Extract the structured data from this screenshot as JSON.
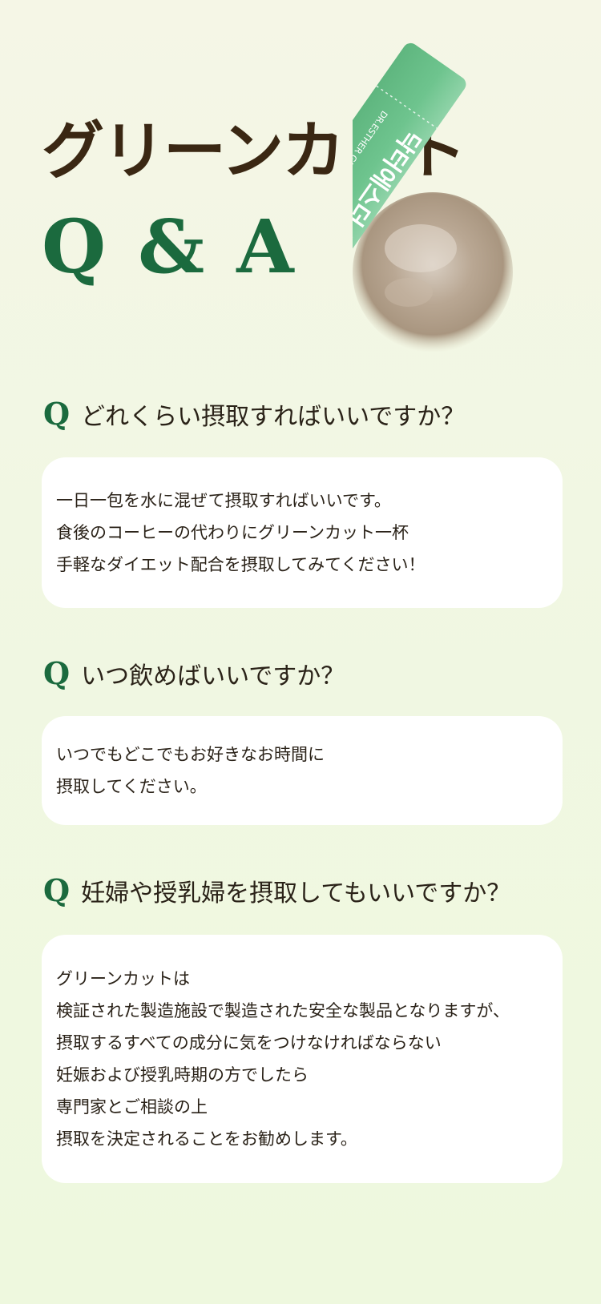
{
  "hero": {
    "title": "グリーンカット",
    "subtitle": "Q & A",
    "product": {
      "stick_label": "닥터에스더 그린",
      "stick_sublabel": "DR.ESTHER GREEN CUT",
      "colors": {
        "stick": "#6bbf8a",
        "stick_dark": "#4ea672",
        "powder": "#b7a591"
      }
    }
  },
  "colors": {
    "title": "#3a2713",
    "accent_green": "#1b6a3e",
    "card": "#ffffff",
    "text": "#2a2218"
  },
  "qa": [
    {
      "q_mark": "Q",
      "question": "どれくらい摂取すればいいですか？",
      "answer_lines": [
        "一日一包を水に混ぜて摂取すればいいです。",
        "食後のコーヒーの代わりにグリーンカット一杯",
        "手軽なダイエット配合を摂取してみてください！"
      ]
    },
    {
      "q_mark": "Q",
      "question": "いつ飲めばいいですか？",
      "answer_lines": [
        "いつでもどこでもお好きなお時間に",
        "摂取してください。"
      ]
    },
    {
      "q_mark": "Q",
      "question": "妊婦や授乳婦を摂取してもいいですか？",
      "answer_lines": [
        "グリーンカットは",
        "検証された製造施設で製造された安全な製品となりますが、",
        "摂取するすべての成分に気をつけなければならない",
        "妊娠および授乳時期の方でしたら",
        "専門家とご相談の上",
        "摂取を決定されることをお勧めします。"
      ]
    }
  ]
}
